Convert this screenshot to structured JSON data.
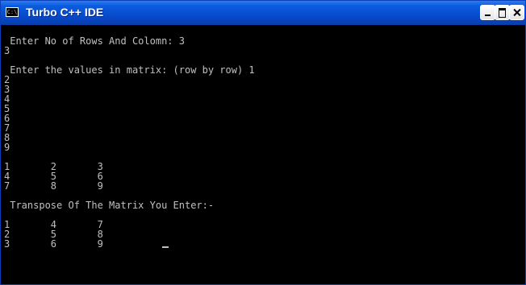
{
  "window": {
    "title": "Turbo C++ IDE",
    "icon": "console-icon",
    "icon_text": "C:\\"
  },
  "console": {
    "lines": [
      " Enter No of Rows And Colomn: 3",
      "3",
      "",
      " Enter the values in matrix: (row by row) 1",
      "2",
      "3",
      "4",
      "5",
      "6",
      "7",
      "8",
      "9",
      "",
      "1       2       3",
      "4       5       6",
      "7       8       9",
      "",
      " Transpose Of The Matrix You Enter:-",
      "",
      "1       4       7",
      "2       5       8",
      "3       6       9"
    ]
  },
  "colors": {
    "titlebar": "#0b5ce0",
    "console_bg": "#000000",
    "console_text": "#c0c0c0"
  }
}
